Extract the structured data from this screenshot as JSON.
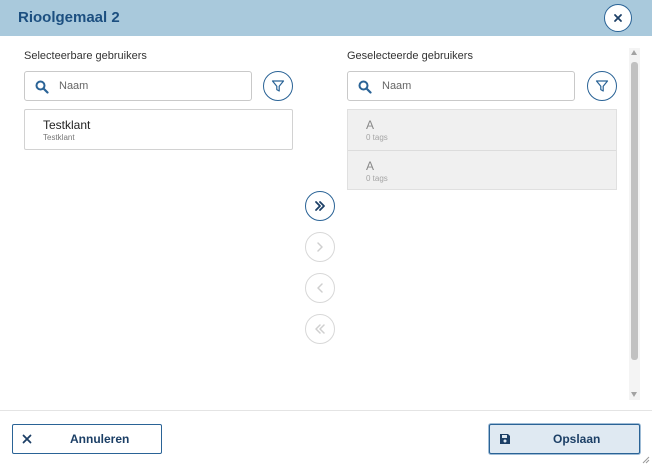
{
  "dialog": {
    "title": "Rioolgemaal 2",
    "close_icon": "close-icon"
  },
  "left_panel": {
    "label": "Selecteerbare gebruikers",
    "search_placeholder": "Naam",
    "filter_icon": "filter-icon",
    "items": [
      {
        "name": "Testklant",
        "subtitle": "Testklant"
      }
    ]
  },
  "right_panel": {
    "label": "Geselecteerde gebruikers",
    "search_placeholder": "Naam",
    "filter_icon": "filter-icon",
    "items": [
      {
        "name": "A",
        "tags": "0 tags"
      },
      {
        "name": "A",
        "tags": "0 tags"
      }
    ]
  },
  "transfer_buttons": [
    {
      "icon": "double-chevron-right-icon",
      "enabled": true
    },
    {
      "icon": "chevron-right-icon",
      "enabled": false
    },
    {
      "icon": "chevron-left-icon",
      "enabled": false
    },
    {
      "icon": "double-chevron-left-icon",
      "enabled": false
    }
  ],
  "footer": {
    "cancel_label": "Annuleren",
    "cancel_icon": "close-icon",
    "save_label": "Opslaan",
    "save_icon": "save-icon"
  },
  "colors": {
    "header_bg": "#a9c9dc",
    "accent": "#2a6396",
    "title": "#1c4f80"
  }
}
